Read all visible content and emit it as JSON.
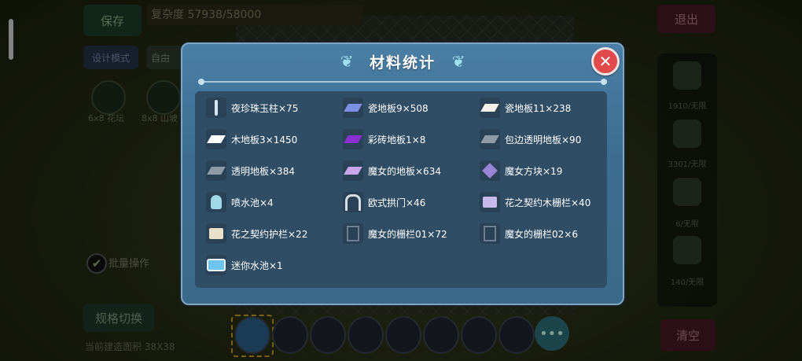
{
  "background": {
    "save_label": "保存",
    "complexity_text": "复杂度 57938/58000",
    "exit_label": "退出",
    "design_mode_label": "设计模式",
    "free_build_label": "自由",
    "preset_labels": [
      "6x8 花坛",
      "8x8 山坡"
    ],
    "batch_label": "批量操作",
    "spec_switch_label": "规格切换",
    "area_text": "当前建造面积 38X38",
    "right_labels": [
      "1910/无限",
      "3301/无限",
      "6/无限",
      "140/无限"
    ],
    "clear_label": "清空",
    "more_label": "•••"
  },
  "dialog": {
    "title": "材料统计",
    "close_label": "✕",
    "items": [
      {
        "label": "夜珍珠玉柱×75",
        "icon": "pillar-icon",
        "color": "#d9e6ee"
      },
      {
        "label": "瓷地板9×508",
        "icon": "blue-tile-icon",
        "color": "#7d8fe0"
      },
      {
        "label": "瓷地板11×238",
        "icon": "white-tile-icon",
        "color": "#f3f0ea"
      },
      {
        "label": "木地板3×1450",
        "icon": "wood-floor-icon",
        "color": "#ffffff"
      },
      {
        "label": "彩砖地板1×8",
        "icon": "purple-tile-icon",
        "color": "#8a2fd0"
      },
      {
        "label": "包边透明地板×90",
        "icon": "clear-floor-icon",
        "color": "#8e9aa6"
      },
      {
        "label": "透明地板×384",
        "icon": "transparent-floor-icon",
        "color": "#8e9aa6"
      },
      {
        "label": "魔女的地板×634",
        "icon": "witch-floor-icon",
        "color": "#c9a6e8"
      },
      {
        "label": "魔女方块×19",
        "icon": "witch-block-icon",
        "color": "#9a84d6"
      },
      {
        "label": "喷水池×4",
        "icon": "fountain-icon",
        "color": "#9fd8e6"
      },
      {
        "label": "欧式拱门×46",
        "icon": "arch-door-icon",
        "color": "#d7dde2"
      },
      {
        "label": "花之契约木栅栏×40",
        "icon": "flower-fence-icon",
        "color": "#c9b8ea"
      },
      {
        "label": "花之契约护栏×22",
        "icon": "flower-rail-icon",
        "color": "#e8e0c8"
      },
      {
        "label": "魔女的栅栏01×72",
        "icon": "witch-fence-icon",
        "color": "#6f7f92"
      },
      {
        "label": "魔女的栅栏02×6",
        "icon": "witch-fence-icon",
        "color": "#6f7f92"
      },
      {
        "label": "迷你水池×1",
        "icon": "mini-pool-icon",
        "color": "#6fc3ef"
      }
    ]
  }
}
